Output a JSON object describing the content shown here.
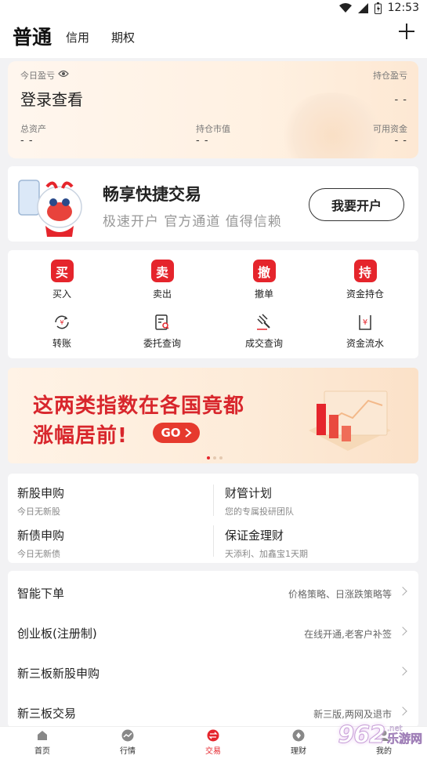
{
  "status_bar": {
    "time": "12:53"
  },
  "header": {
    "tabs": [
      {
        "label": "普通"
      },
      {
        "label": "信用"
      },
      {
        "label": "期权"
      }
    ]
  },
  "asset": {
    "today_pl_label": "今日盈亏",
    "login_text": "登录查看",
    "holding_pl_label": "持仓盈亏",
    "holding_pl_value": "- -",
    "total_assets_label": "总资产",
    "total_assets_value": "- -",
    "market_value_label": "持仓市值",
    "market_value_value": "- -",
    "available_label": "可用资金",
    "available_value": "- -"
  },
  "promo": {
    "title": "畅享快捷交易",
    "subtitle": "极速开户 官方通道 值得信赖",
    "button": "我要开户"
  },
  "trade_grid": {
    "row1": [
      {
        "badge": "买",
        "label": "买入"
      },
      {
        "badge": "卖",
        "label": "卖出"
      },
      {
        "badge": "撤",
        "label": "撤单"
      },
      {
        "badge": "持",
        "label": "资金持仓"
      }
    ],
    "row2": [
      {
        "icon": "transfer-icon",
        "label": "转账"
      },
      {
        "icon": "order-query-icon",
        "label": "委托查询"
      },
      {
        "icon": "deal-query-icon",
        "label": "成交查询"
      },
      {
        "icon": "fund-flow-icon",
        "label": "资金流水"
      }
    ]
  },
  "banner": {
    "line1": "这两类指数在各国竟都",
    "line2": "涨幅居前!",
    "go": "GO",
    "accent_color": "#d8262c"
  },
  "services": [
    {
      "title": "新股申购",
      "desc": "今日无新股"
    },
    {
      "title": "财管计划",
      "desc": "您的专属投研团队"
    },
    {
      "title": "新债申购",
      "desc": "今日无新债"
    },
    {
      "title": "保证金理财",
      "desc": "天添利、加鑫宝1天期"
    }
  ],
  "list": [
    {
      "title": "智能下单",
      "hint": "价格策略、日涨跌策略等"
    },
    {
      "title": "创业板(注册制)",
      "hint": "在线开通,老客户补签"
    },
    {
      "title": "新三板新股申购",
      "hint": ""
    },
    {
      "title": "新三板交易",
      "hint": "新三版,两网及退市"
    }
  ],
  "bottom_nav": [
    {
      "label": "首页",
      "icon": "home-icon"
    },
    {
      "label": "行情",
      "icon": "market-icon"
    },
    {
      "label": "交易",
      "icon": "trade-icon",
      "active": true
    },
    {
      "label": "理财",
      "icon": "wealth-icon"
    },
    {
      "label": "我的",
      "icon": "profile-icon"
    }
  ],
  "watermark": {
    "number": "962",
    "suffix": ".net",
    "site": "乐游网"
  }
}
